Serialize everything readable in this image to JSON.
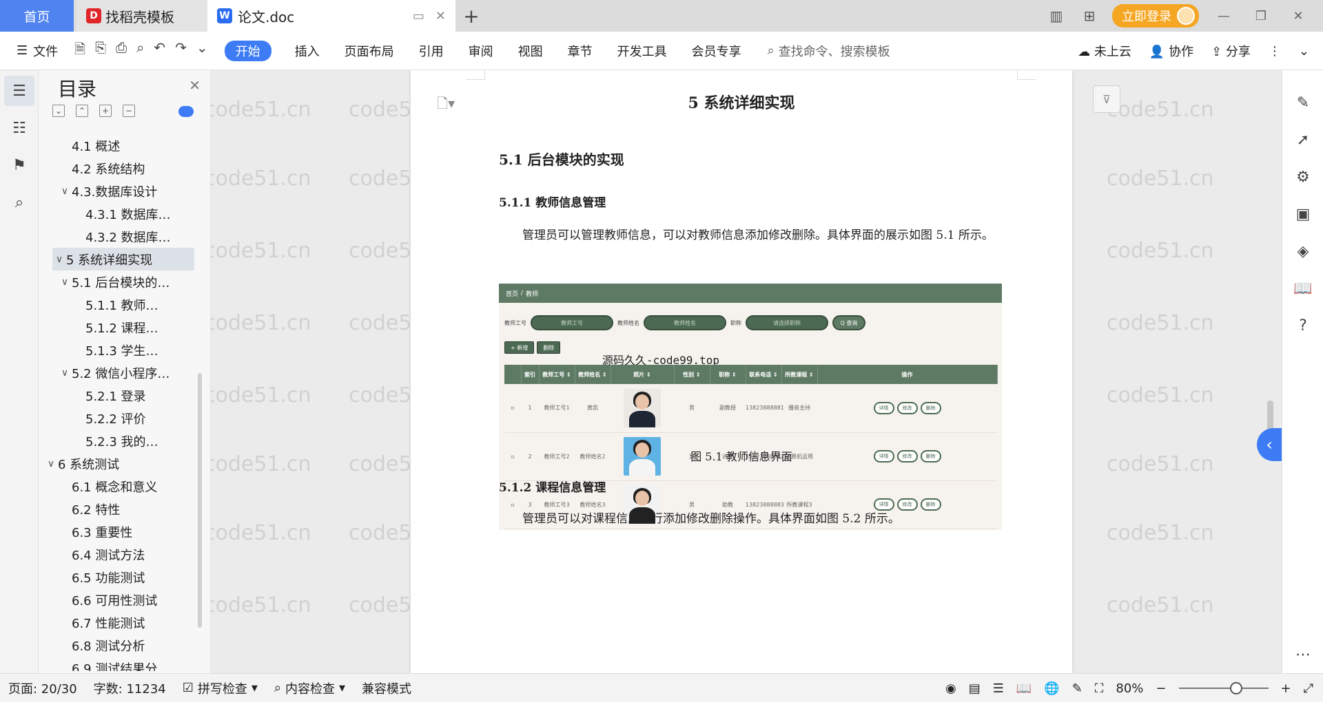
{
  "tabs": {
    "home": "首页",
    "template": "找稻壳模板",
    "doc": "论文.doc",
    "add": "+"
  },
  "header_right": {
    "login": "立即登录"
  },
  "ribbon": {
    "file": "文件",
    "menu": [
      "开始",
      "插入",
      "页面布局",
      "引用",
      "审阅",
      "视图",
      "章节",
      "开发工具",
      "会员专享"
    ],
    "search": "查找命令、搜索模板",
    "cloud": "未上云",
    "collab": "协作",
    "share": "分享"
  },
  "toc": {
    "title": "目录",
    "items": [
      {
        "label": "4.1 概述",
        "level": 2,
        "arrow": ""
      },
      {
        "label": "4.2 系统结构",
        "level": 2,
        "arrow": ""
      },
      {
        "label": "4.3.数据库设计",
        "level": 2,
        "arrow": "v"
      },
      {
        "label": "4.3.1 数据库…",
        "level": 3,
        "arrow": ""
      },
      {
        "label": "4.3.2 数据库…",
        "level": 3,
        "arrow": ""
      },
      {
        "label": "5 系统详细实现",
        "level": 1,
        "arrow": "v"
      },
      {
        "label": "5.1  后台模块的…",
        "level": 2,
        "arrow": "v"
      },
      {
        "label": "5.1.1  教师…",
        "level": 3,
        "arrow": ""
      },
      {
        "label": "5.1.2  课程…",
        "level": 3,
        "arrow": ""
      },
      {
        "label": "5.1.3  学生…",
        "level": 3,
        "arrow": ""
      },
      {
        "label": "5.2  微信小程序…",
        "level": 2,
        "arrow": "v"
      },
      {
        "label": "5.2.1  登录",
        "level": 3,
        "arrow": ""
      },
      {
        "label": "5.2.2  评价",
        "level": 3,
        "arrow": ""
      },
      {
        "label": "5.2.3  我的…",
        "level": 3,
        "arrow": ""
      },
      {
        "label": "6 系统测试",
        "level": 1,
        "arrow": "v"
      },
      {
        "label": "6.1 概念和意义",
        "level": 2,
        "arrow": ""
      },
      {
        "label": "6.2 特性",
        "level": 2,
        "arrow": ""
      },
      {
        "label": "6.3 重要性",
        "level": 2,
        "arrow": ""
      },
      {
        "label": "6.4 测试方法",
        "level": 2,
        "arrow": ""
      },
      {
        "label": "6.5  功能测试",
        "level": 2,
        "arrow": ""
      },
      {
        "label": "6.6 可用性测试",
        "level": 2,
        "arrow": ""
      },
      {
        "label": "6.7 性能测试",
        "level": 2,
        "arrow": ""
      },
      {
        "label": "6.8 测试分析",
        "level": 2,
        "arrow": ""
      },
      {
        "label": "6.9 测试结果分",
        "level": 2,
        "arrow": ""
      }
    ],
    "selected_index": 5
  },
  "document": {
    "h1": "5 系统详细实现",
    "h2": "5.1  后台模块的实现",
    "h3_1": "5.1.1  教师信息管理",
    "para1": "管理员可以管理教师信息，可以对教师信息添加修改删除。具体界面的展示如图 5.1 所示。",
    "caption": "图 5.1  教师信息界面",
    "h3_2": "5.1.2  课程信息管理",
    "para2": "管理员可以对课程信息进行添加修改删除操作。具体界面如图 5.2 所示。",
    "watermark": "code51.cn"
  },
  "screenshot": {
    "breadcrumb": [
      "首页",
      "/",
      "教师"
    ],
    "filters": [
      {
        "label": "教师工号",
        "placeholder": "教师工号"
      },
      {
        "label": "教师姓名",
        "placeholder": "教师姓名"
      },
      {
        "label": "职称",
        "placeholder": "请选择职称"
      }
    ],
    "search": "Q 查询",
    "add": "+ 新增",
    "delete": "删除",
    "overlay": "源码久久-code99.top",
    "columns": [
      "",
      "索引",
      "教师工号 ⇕",
      "教师姓名 ⇕",
      "照片 ⇕",
      "性别 ⇕",
      "职称 ⇕",
      "联系电话 ⇕",
      "所教课程 ⇕",
      "操作"
    ],
    "rows": [
      {
        "idx": "1",
        "no": "教师工号1",
        "name": "黄凯",
        "gender": "男",
        "title": "副教授",
        "phone": "13823888881",
        "course": "播音主持"
      },
      {
        "idx": "2",
        "no": "教师工号2",
        "name": "教师姓名2",
        "gender": "男",
        "title": "讲师",
        "phone": "13823888882",
        "course": "计算机运用"
      },
      {
        "idx": "3",
        "no": "教师工号3",
        "name": "教师姓名3",
        "gender": "男",
        "title": "助教",
        "phone": "13823888883",
        "course": "所教课程3"
      }
    ],
    "ops": [
      "详情",
      "修改",
      "删除"
    ]
  },
  "statusbar": {
    "page": "页面: 20/30",
    "words": "字数: 11234",
    "spell": "拼写检查",
    "content": "内容检查",
    "compat": "兼容模式",
    "zoom": "80%"
  },
  "colors": {
    "accent": "#3d7cf5",
    "login": "#f5a623",
    "shot_header": "#5e7a64"
  }
}
